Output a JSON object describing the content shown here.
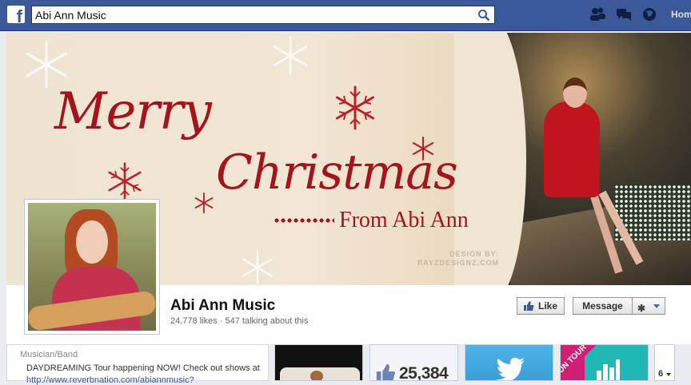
{
  "topbar": {
    "search_value": "Abi Ann Music",
    "home_label": "Hom",
    "logo_letter": "f"
  },
  "cover": {
    "line1": "Merry",
    "line2": "Christmas",
    "line3": "From Abi Ann",
    "credit_line1": "DESIGN BY:",
    "credit_line2": "RAYZDESIGNZ.COM"
  },
  "page": {
    "name": "Abi Ann Music",
    "stats": "24,778 likes · 547 talking about this"
  },
  "actions": {
    "like_label": "Like",
    "message_label": "Message"
  },
  "about": {
    "category": "Musician/Band",
    "text": "DAYDREAMING Tour happening NOW! Check out shows at",
    "link": "http://www.reverbnation.com/abiannmusic?"
  },
  "tabs": {
    "likes_count": "25,384",
    "tour_label": "ON TOUR",
    "more_count": "6"
  },
  "colors": {
    "facebook_blue": "#3b5998",
    "cover_red": "#a3141c",
    "tour_pink": "#d21f76",
    "tour_teal": "#21b7b4",
    "twitter_blue": "#4fb3e8"
  }
}
